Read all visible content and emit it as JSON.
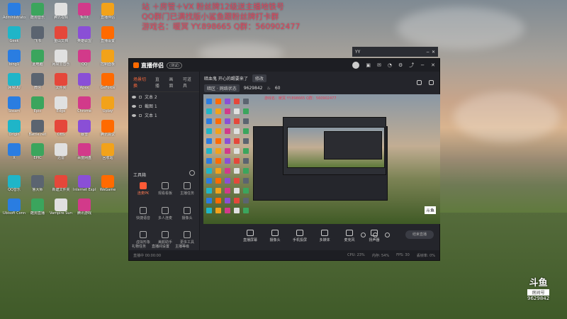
{
  "overlay": {
    "line1": "站 ＋房管＋VX 粉丝牌12级送主播地铁号",
    "line2": "QQ群门已满找版小鲨鱼跟粉丝牌打卡群",
    "line3": "游戏名：暖冥 YY.898665 Q群：560902477"
  },
  "yy": {
    "title": "YY",
    "min": "−",
    "close": "✕"
  },
  "app": {
    "title": "直播伴侣",
    "version": "(测试)",
    "tabs": [
      "场景切换",
      "直播",
      "画面",
      "可道具"
    ],
    "scenes": [
      "文本 2",
      "截图 1",
      "文本 1"
    ],
    "tools_header": "工具箱",
    "tools": [
      {
        "label": "连麦PK"
      },
      {
        "label": "观看看板"
      },
      {
        "label": "主播任务"
      },
      {
        "label": "快捷语音"
      },
      {
        "label": "多人连麦"
      },
      {
        "label": "摄像头"
      },
      {
        "label": "虚拟形象"
      },
      {
        "label": "美颜助手"
      },
      {
        "label": "更多工具"
      }
    ],
    "left_footer": [
      "礼物任务",
      "直播间设置",
      "主播等级"
    ],
    "room_title": "暗血鬼 开心的踢要来了",
    "room_edit": "修改",
    "room_chip": "暗区 · 网络状态",
    "room_id": "9629842",
    "room_heat": "60",
    "controls": [
      "直播屏幕",
      "摄像头",
      "手机投屏",
      "多媒体",
      "麦克风",
      "扬声器"
    ],
    "go_live": "结束直播",
    "status": [
      "直播中 00:00:00",
      "CPU: 23%",
      "内存: 54%",
      "FPS: 30",
      "丢帧率: 0%"
    ]
  },
  "watermark": {
    "brand": "斗鱼",
    "sub": "房间号",
    "room": "9629842"
  },
  "desktop_icons": [
    {
      "label": "Administrator"
    },
    {
      "label": "酷狗音乐"
    },
    {
      "label": "腾讯视频"
    },
    {
      "label": "TeXit"
    },
    {
      "label": "直播伴侣"
    },
    {
      "label": "Geek"
    },
    {
      "label": "飞书"
    },
    {
      "label": "金山文档"
    },
    {
      "label": "英雄联盟"
    },
    {
      "label": "直播设置"
    },
    {
      "label": "bing1"
    },
    {
      "label": "此电脑"
    },
    {
      "label": "网易云音乐"
    },
    {
      "label": "QQ"
    },
    {
      "label": "控制面板"
    },
    {
      "label": "网易UU"
    },
    {
      "label": "微信"
    },
    {
      "label": "文件夹"
    },
    {
      "label": "Apex"
    },
    {
      "label": "GeForce"
    },
    {
      "label": "Steam"
    },
    {
      "label": "Epic"
    },
    {
      "label": "Edge"
    },
    {
      "label": "Chrome"
    },
    {
      "label": "Uplay"
    },
    {
      "label": "Origin"
    },
    {
      "label": "Battle.net"
    },
    {
      "label": "OBS"
    },
    {
      "label": "暴雪"
    },
    {
      "label": "腾讯会议"
    },
    {
      "label": "X"
    },
    {
      "label": "EPIC"
    },
    {
      "label": "迅雷"
    },
    {
      "label": "百度网盘"
    },
    {
      "label": "回收站"
    },
    {
      "label": "QQ音乐"
    },
    {
      "label": "鲁大师"
    },
    {
      "label": "新建文件夹"
    },
    {
      "label": "Internet Explorer"
    },
    {
      "label": "WeGame"
    },
    {
      "label": "Ubisoft Connect"
    },
    {
      "label": "酷狗直播"
    },
    {
      "label": "Vampire Survivors"
    },
    {
      "label": "腾讯游戏"
    }
  ]
}
